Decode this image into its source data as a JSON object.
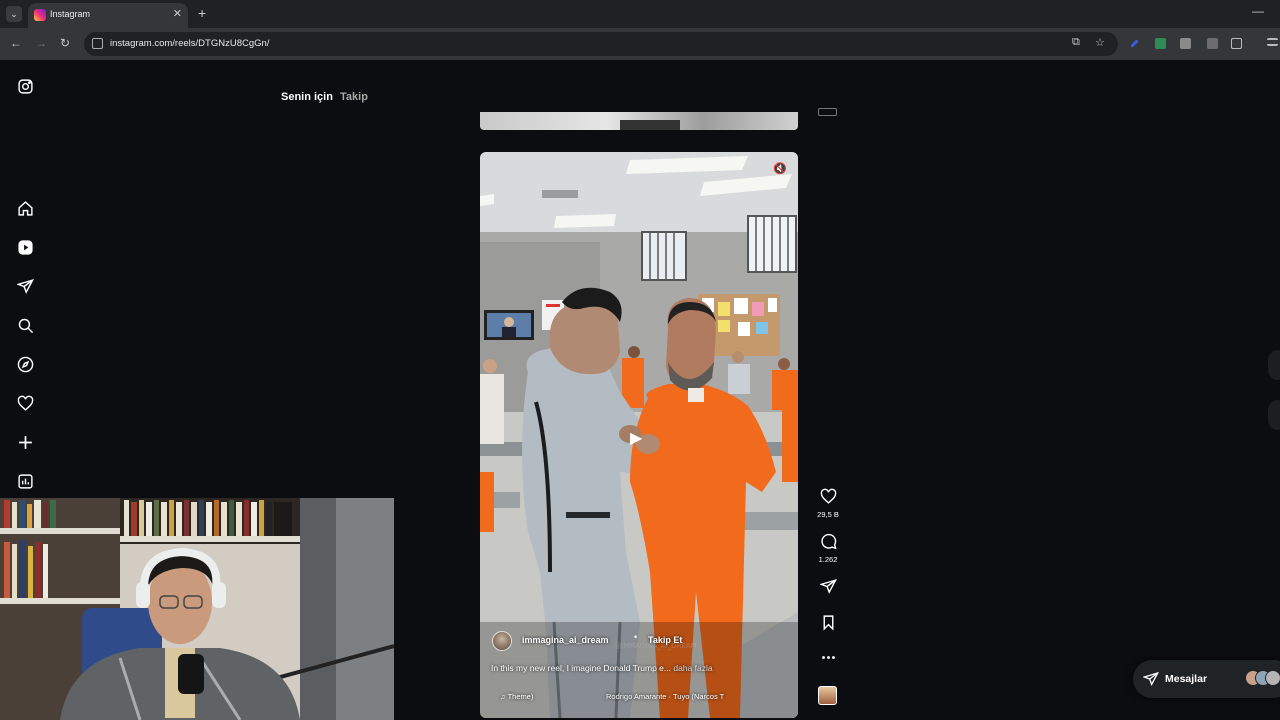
{
  "browser": {
    "tab_title": "Instagram",
    "url": "instagram.com/reels/DTGNzU8CgGn/"
  },
  "feed": {
    "tab_for_you": "Senin için",
    "tab_following": "Takip"
  },
  "reel": {
    "author": "immagina_ai_dream",
    "separator": "•",
    "follow_label": "Takip Et",
    "caption": "In this my new reel, I imagine Donald Trump e...",
    "caption_more": " daha fazla",
    "audio_label": "Theme)",
    "music": "Rodrigo Amarante · Tuyo (Narcos T"
  },
  "actions": {
    "likes": "29,5 B",
    "comments": "1.262"
  },
  "messages": {
    "label": "Mesajlar"
  },
  "colors": {
    "background": "#0b0d10",
    "jumpsuit": "#f26a1b",
    "instagram_gradient": [
      "#f9ce34",
      "#ee2a7b",
      "#6228d7"
    ]
  },
  "icons": [
    "instagram-logo-icon",
    "home-icon",
    "reels-icon",
    "direct-send-icon",
    "search-icon",
    "explore-compass-icon",
    "heart-icon",
    "create-plus-icon",
    "dashboard-icon",
    "mute-icon",
    "play-icon",
    "comment-icon",
    "share-icon",
    "bookmark-icon",
    "more-icon",
    "music-note-icon"
  ]
}
